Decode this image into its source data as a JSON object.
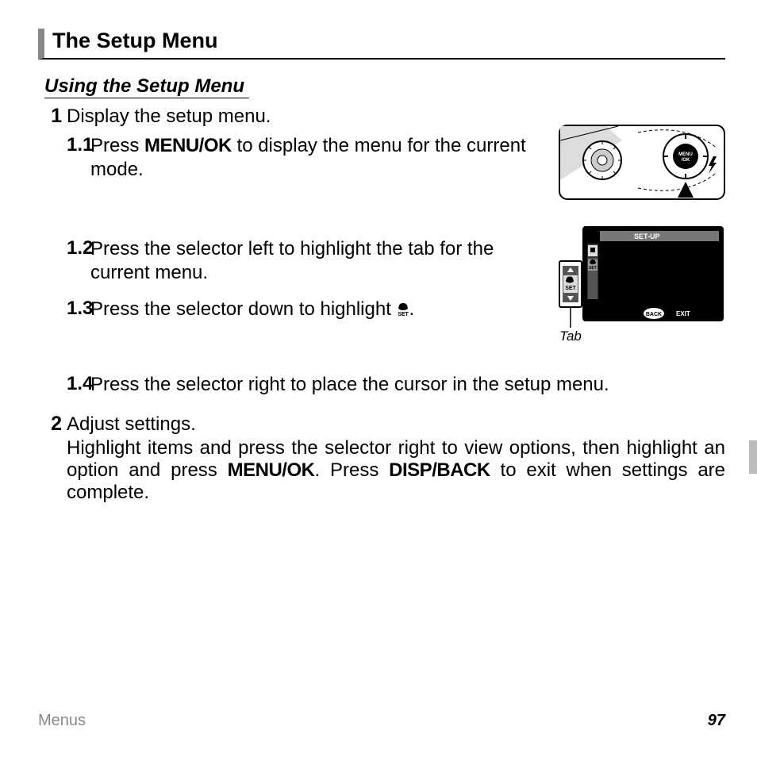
{
  "header": {
    "title": "The Setup Menu"
  },
  "subsection": {
    "title": "Using the Setup Menu"
  },
  "steps": {
    "s1": {
      "num": "1",
      "title": "Display the setup menu.",
      "sub1_num": "1.1",
      "sub1_a": "Press ",
      "sub1_b": "MENU/OK",
      "sub1_c": " to display the menu for the current mode.",
      "sub2_num": "1.2",
      "sub2_text": "Press the selector left to highlight the tab for the current menu.",
      "sub3_num": "1.3",
      "sub3_a": "Press the selector down to highlight ",
      "sub3_b": ".",
      "sub4_num": "1.4",
      "sub4_text": "Press the selector right to place the cursor in the setup menu."
    },
    "s2": {
      "num": "2",
      "title": "Adjust settings.",
      "body_a": "Highlight items and press the selector right to view options, then highlight an option and press ",
      "body_b": "MENU/OK",
      "body_c": ". Press ",
      "body_d": "DISP/BACK",
      "body_e": " to exit when settings are complete."
    }
  },
  "figures": {
    "camera_label": "MENU/OK",
    "screen_title": "SET-UP",
    "screen_back": "BACK",
    "screen_exit": "EXIT",
    "screen_tab_label": "Tab",
    "tab_set": "SET",
    "set_icon_label": "SET"
  },
  "footer": {
    "left": "Menus",
    "right": "97"
  }
}
